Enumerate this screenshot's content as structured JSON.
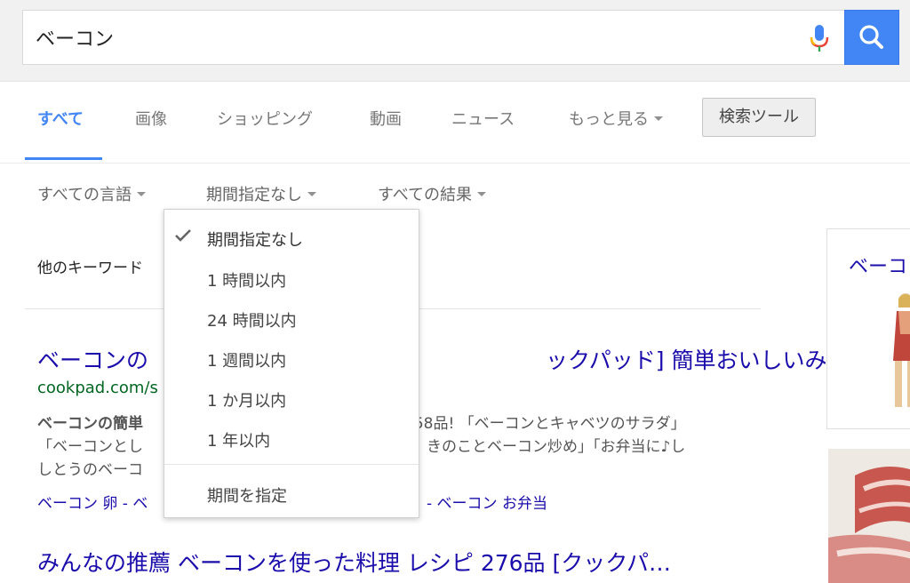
{
  "search": {
    "query": "ベーコン",
    "mic_label": "voice-search",
    "button_label": "search"
  },
  "tabs": [
    {
      "label": "すべて",
      "active": true
    },
    {
      "label": "画像"
    },
    {
      "label": "ショッピング"
    },
    {
      "label": "動画"
    },
    {
      "label": "ニュース"
    },
    {
      "label": "もっと見る"
    }
  ],
  "tools_label": "検索ツール",
  "filters": {
    "language": "すべての言語",
    "time": "期間指定なし",
    "results": "すべての結果"
  },
  "other_keywords": "他のキーワード",
  "time_menu": {
    "items": [
      "期間指定なし",
      "1 時間以内",
      "24 時間以内",
      "1 週間以内",
      "1 か月以内",
      "1 年以内"
    ],
    "selected_index": 0,
    "custom": "期間を指定"
  },
  "results": [
    {
      "title_left": "ベーコンの",
      "title_right": "ックパッド] 簡単おいしいみん…",
      "url": "cookpad.com/s",
      "snippet_lines": [
        {
          "left": "ベーコンの簡単",
          "right": "358品! 「ベーコンとキャベツのサラダ」"
        },
        {
          "left": "「ベーコンとし",
          "right": "きのことベーコン炒め」「お弁当に♪し"
        },
        {
          "left": "しとうのベーコ",
          "right": ""
        }
      ],
      "sitelinks_left": "ベーコン 卵 - ベ",
      "sitelinks_right": "- ベーコン お弁当"
    },
    {
      "title": "みんなの推薦 ベーコンを使った料理 レシピ 276品 [クックパ…"
    }
  ],
  "knowledge_panel": {
    "title": "ベーコ"
  },
  "colors": {
    "link": "#1a0dab",
    "url": "#006621",
    "accent": "#4285f4",
    "snippet": "#545454"
  }
}
